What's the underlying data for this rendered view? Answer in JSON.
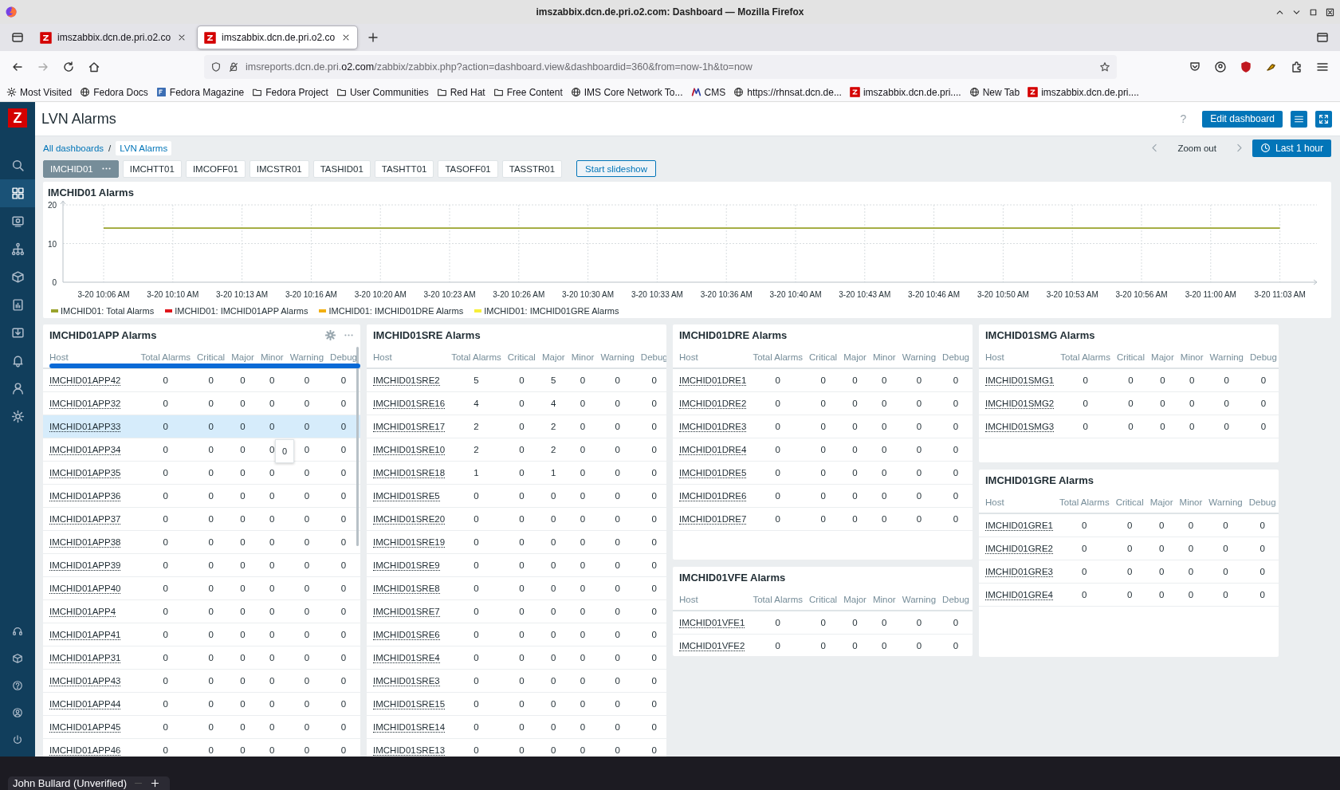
{
  "browser": {
    "window_title": "imszabbix.dcn.de.pri.o2.com: Dashboard — Mozilla Firefox",
    "tabs": [
      {
        "title": "imszabbix.dcn.de.pri.o2.co",
        "selected": false
      },
      {
        "title": "imszabbix.dcn.de.pri.o2.co",
        "selected": true
      }
    ],
    "url": {
      "subdomain": "imsreports.dcn.de.pri.",
      "domain": "o2.com",
      "path": "/zabbix/zabbix.php?action=dashboard.view&dashboardid=360&from=now-1h&to=now"
    },
    "bookmarks": [
      {
        "label": "Most Visited",
        "kind": "gear"
      },
      {
        "label": "Fedora Docs",
        "kind": "globe"
      },
      {
        "label": "Fedora Magazine",
        "kind": "badge"
      },
      {
        "label": "Fedora Project",
        "kind": "folder"
      },
      {
        "label": "User Communities",
        "kind": "folder"
      },
      {
        "label": "Red Hat",
        "kind": "folder"
      },
      {
        "label": "Free Content",
        "kind": "folder"
      },
      {
        "label": "IMS Core Network To...",
        "kind": "globe"
      },
      {
        "label": "CMS",
        "kind": "cms"
      },
      {
        "label": "https://rhnsat.dcn.de...",
        "kind": "globe"
      },
      {
        "label": "imszabbix.dcn.de.pri....",
        "kind": "zabbix"
      },
      {
        "label": "New Tab",
        "kind": "globe"
      },
      {
        "label": "imszabbix.dcn.de.pri....",
        "kind": "zabbix"
      }
    ]
  },
  "sidebar": {
    "logo": "Z",
    "items": [
      {
        "kind": "search",
        "selected": false
      },
      {
        "kind": "grid",
        "selected": true
      },
      {
        "kind": "monitor",
        "selected": false
      },
      {
        "kind": "network",
        "selected": false
      },
      {
        "kind": "cube",
        "selected": false
      },
      {
        "kind": "report",
        "selected": false
      },
      {
        "kind": "inbox",
        "selected": false
      },
      {
        "kind": "bell",
        "selected": false
      },
      {
        "kind": "users",
        "selected": false
      },
      {
        "kind": "gear",
        "selected": false
      }
    ],
    "bottom_items": [
      {
        "kind": "headset"
      },
      {
        "kind": "cube"
      },
      {
        "kind": "help"
      },
      {
        "kind": "user"
      },
      {
        "kind": "power"
      }
    ]
  },
  "header": {
    "title": "LVN Alarms",
    "help": "?",
    "edit_button": "Edit dashboard"
  },
  "breadcrumbs": {
    "items": [
      "All dashboards",
      "LVN Alarms"
    ],
    "separator": "/"
  },
  "time_controls": {
    "zoom_out": "Zoom out",
    "period": "Last 1 hour"
  },
  "dashboard_pages": [
    {
      "label": "IMCHID01",
      "selected": true
    },
    {
      "label": "IMCHTT01",
      "selected": false
    },
    {
      "label": "IMCOFF01",
      "selected": false
    },
    {
      "label": "IMCSTR01",
      "selected": false
    },
    {
      "label": "TASHID01",
      "selected": false
    },
    {
      "label": "TASHTT01",
      "selected": false
    },
    {
      "label": "TASOFF01",
      "selected": false
    },
    {
      "label": "TASSTR01",
      "selected": false
    }
  ],
  "slideshow_button": "Start slideshow",
  "graph_widget": {
    "chart_data": {
      "type": "line",
      "title": "IMCHID01 Alarms",
      "grid": true,
      "ylim": [
        0,
        20
      ],
      "yticks": [
        0,
        10,
        20
      ],
      "categories": [
        "3-20 10:06 AM",
        "3-20 10:10 AM",
        "3-20 10:13 AM",
        "3-20 10:16 AM",
        "3-20 10:20 AM",
        "3-20 10:23 AM",
        "3-20 10:26 AM",
        "3-20 10:30 AM",
        "3-20 10:33 AM",
        "3-20 10:36 AM",
        "3-20 10:40 AM",
        "3-20 10:43 AM",
        "3-20 10:46 AM",
        "3-20 10:50 AM",
        "3-20 10:53 AM",
        "3-20 10:56 AM",
        "3-20 11:00 AM",
        "3-20 11:03 AM"
      ],
      "series": [
        {
          "name": "IMCHID01: Total Alarms",
          "color": "#9aa32c",
          "values": [
            14,
            14,
            14,
            14,
            14,
            14,
            14,
            14,
            14,
            14,
            14,
            14,
            14,
            14,
            14,
            14,
            14,
            14
          ]
        },
        {
          "name": "IMCHID01: IMCHID01APP Alarms",
          "color": "#e0161c",
          "values": [
            null,
            null,
            null,
            null,
            null,
            null,
            null,
            null,
            null,
            null,
            null,
            null,
            null,
            null,
            null,
            null,
            null,
            null
          ]
        },
        {
          "name": "IMCHID01: IMCHID01DRE Alarms",
          "color": "#f2b013",
          "values": [
            null,
            null,
            null,
            null,
            null,
            null,
            null,
            null,
            null,
            null,
            null,
            null,
            null,
            null,
            null,
            null,
            null,
            null
          ]
        },
        {
          "name": "IMCHID01: IMCHID01GRE Alarms",
          "color": "#f7ef3a",
          "values": [
            null,
            null,
            null,
            null,
            null,
            null,
            null,
            null,
            null,
            null,
            null,
            null,
            null,
            null,
            null,
            null,
            null,
            null
          ]
        }
      ]
    }
  },
  "widget_columns": [
    {
      "widgets": [
        {
          "title": "IMCHID01APP Alarms",
          "show_controls": true,
          "scrollbar": true,
          "highlight_stroke": true,
          "tooltip": "0",
          "columns": [
            "Host",
            "Total Alarms",
            "Critical",
            "Major",
            "Minor",
            "Warning",
            "Debug"
          ],
          "rows": [
            {
              "host": "IMCHID01APP42",
              "values": [
                "0",
                "0",
                "0",
                "0",
                "0",
                "0"
              ],
              "hovered": false
            },
            {
              "host": "IMCHID01APP32",
              "values": [
                "0",
                "0",
                "0",
                "0",
                "0",
                "0"
              ],
              "hovered": false
            },
            {
              "host": "IMCHID01APP33",
              "values": [
                "0",
                "0",
                "0",
                "0",
                "0",
                "0"
              ],
              "hovered": true
            },
            {
              "host": "IMCHID01APP34",
              "values": [
                "0",
                "0",
                "0",
                "0",
                "0",
                "0"
              ],
              "hovered": false
            },
            {
              "host": "IMCHID01APP35",
              "values": [
                "0",
                "0",
                "0",
                "0",
                "0",
                "0"
              ],
              "hovered": false
            },
            {
              "host": "IMCHID01APP36",
              "values": [
                "0",
                "0",
                "0",
                "0",
                "0",
                "0"
              ],
              "hovered": false
            },
            {
              "host": "IMCHID01APP37",
              "values": [
                "0",
                "0",
                "0",
                "0",
                "0",
                "0"
              ],
              "hovered": false
            },
            {
              "host": "IMCHID01APP38",
              "values": [
                "0",
                "0",
                "0",
                "0",
                "0",
                "0"
              ],
              "hovered": false
            },
            {
              "host": "IMCHID01APP39",
              "values": [
                "0",
                "0",
                "0",
                "0",
                "0",
                "0"
              ],
              "hovered": false
            },
            {
              "host": "IMCHID01APP40",
              "values": [
                "0",
                "0",
                "0",
                "0",
                "0",
                "0"
              ],
              "hovered": false
            },
            {
              "host": "IMCHID01APP4",
              "values": [
                "0",
                "0",
                "0",
                "0",
                "0",
                "0"
              ],
              "hovered": false
            },
            {
              "host": "IMCHID01APP41",
              "values": [
                "0",
                "0",
                "0",
                "0",
                "0",
                "0"
              ],
              "hovered": false
            },
            {
              "host": "IMCHID01APP31",
              "values": [
                "0",
                "0",
                "0",
                "0",
                "0",
                "0"
              ],
              "hovered": false
            },
            {
              "host": "IMCHID01APP43",
              "values": [
                "0",
                "0",
                "0",
                "0",
                "0",
                "0"
              ],
              "hovered": false
            },
            {
              "host": "IMCHID01APP44",
              "values": [
                "0",
                "0",
                "0",
                "0",
                "0",
                "0"
              ],
              "hovered": false
            },
            {
              "host": "IMCHID01APP45",
              "values": [
                "0",
                "0",
                "0",
                "0",
                "0",
                "0"
              ],
              "hovered": false
            },
            {
              "host": "IMCHID01APP46",
              "values": [
                "0",
                "0",
                "0",
                "0",
                "0",
                "0"
              ],
              "hovered": false
            }
          ]
        }
      ]
    },
    {
      "widgets": [
        {
          "title": "IMCHID01SRE Alarms",
          "columns": [
            "Host",
            "Total Alarms",
            "Critical",
            "Major",
            "Minor",
            "Warning",
            "Debug"
          ],
          "rows": [
            {
              "host": "IMCHID01SRE2",
              "values": [
                "5",
                "0",
                "5",
                "0",
                "0",
                "0"
              ]
            },
            {
              "host": "IMCHID01SRE16",
              "values": [
                "4",
                "0",
                "4",
                "0",
                "0",
                "0"
              ]
            },
            {
              "host": "IMCHID01SRE17",
              "values": [
                "2",
                "0",
                "2",
                "0",
                "0",
                "0"
              ]
            },
            {
              "host": "IMCHID01SRE10",
              "values": [
                "2",
                "0",
                "2",
                "0",
                "0",
                "0"
              ]
            },
            {
              "host": "IMCHID01SRE18",
              "values": [
                "1",
                "0",
                "1",
                "0",
                "0",
                "0"
              ]
            },
            {
              "host": "IMCHID01SRE5",
              "values": [
                "0",
                "0",
                "0",
                "0",
                "0",
                "0"
              ]
            },
            {
              "host": "IMCHID01SRE20",
              "values": [
                "0",
                "0",
                "0",
                "0",
                "0",
                "0"
              ]
            },
            {
              "host": "IMCHID01SRE19",
              "values": [
                "0",
                "0",
                "0",
                "0",
                "0",
                "0"
              ]
            },
            {
              "host": "IMCHID01SRE9",
              "values": [
                "0",
                "0",
                "0",
                "0",
                "0",
                "0"
              ]
            },
            {
              "host": "IMCHID01SRE8",
              "values": [
                "0",
                "0",
                "0",
                "0",
                "0",
                "0"
              ]
            },
            {
              "host": "IMCHID01SRE7",
              "values": [
                "0",
                "0",
                "0",
                "0",
                "0",
                "0"
              ]
            },
            {
              "host": "IMCHID01SRE6",
              "values": [
                "0",
                "0",
                "0",
                "0",
                "0",
                "0"
              ]
            },
            {
              "host": "IMCHID01SRE4",
              "values": [
                "0",
                "0",
                "0",
                "0",
                "0",
                "0"
              ]
            },
            {
              "host": "IMCHID01SRE3",
              "values": [
                "0",
                "0",
                "0",
                "0",
                "0",
                "0"
              ]
            },
            {
              "host": "IMCHID01SRE15",
              "values": [
                "0",
                "0",
                "0",
                "0",
                "0",
                "0"
              ]
            },
            {
              "host": "IMCHID01SRE14",
              "values": [
                "0",
                "0",
                "0",
                "0",
                "0",
                "0"
              ]
            },
            {
              "host": "IMCHID01SRE13",
              "values": [
                "0",
                "0",
                "0",
                "0",
                "0",
                "0"
              ]
            }
          ]
        }
      ]
    },
    {
      "widgets": [
        {
          "title": "IMCHID01DRE Alarms",
          "columns": [
            "Host",
            "Total Alarms",
            "Critical",
            "Major",
            "Minor",
            "Warning",
            "Debug"
          ],
          "rows": [
            {
              "host": "IMCHID01DRE1",
              "values": [
                "0",
                "0",
                "0",
                "0",
                "0",
                "0"
              ]
            },
            {
              "host": "IMCHID01DRE2",
              "values": [
                "0",
                "0",
                "0",
                "0",
                "0",
                "0"
              ]
            },
            {
              "host": "IMCHID01DRE3",
              "values": [
                "0",
                "0",
                "0",
                "0",
                "0",
                "0"
              ]
            },
            {
              "host": "IMCHID01DRE4",
              "values": [
                "0",
                "0",
                "0",
                "0",
                "0",
                "0"
              ]
            },
            {
              "host": "IMCHID01DRE5",
              "values": [
                "0",
                "0",
                "0",
                "0",
                "0",
                "0"
              ]
            },
            {
              "host": "IMCHID01DRE6",
              "values": [
                "0",
                "0",
                "0",
                "0",
                "0",
                "0"
              ]
            },
            {
              "host": "IMCHID01DRE7",
              "values": [
                "0",
                "0",
                "0",
                "0",
                "0",
                "0"
              ]
            }
          ]
        },
        {
          "title": "IMCHID01VFE Alarms",
          "columns": [
            "Host",
            "Total Alarms",
            "Critical",
            "Major",
            "Minor",
            "Warning",
            "Debug"
          ],
          "rows": [
            {
              "host": "IMCHID01VFE1",
              "values": [
                "0",
                "0",
                "0",
                "0",
                "0",
                "0"
              ]
            },
            {
              "host": "IMCHID01VFE2",
              "values": [
                "0",
                "0",
                "0",
                "0",
                "0",
                "0"
              ]
            }
          ]
        }
      ]
    },
    {
      "widgets": [
        {
          "title": "IMCHID01SMG Alarms",
          "columns": [
            "Host",
            "Total Alarms",
            "Critical",
            "Major",
            "Minor",
            "Warning",
            "Debug"
          ],
          "rows": [
            {
              "host": "IMCHID01SMG1",
              "values": [
                "0",
                "0",
                "0",
                "0",
                "0",
                "0"
              ]
            },
            {
              "host": "IMCHID01SMG2",
              "values": [
                "0",
                "0",
                "0",
                "0",
                "0",
                "0"
              ]
            },
            {
              "host": "IMCHID01SMG3",
              "values": [
                "0",
                "0",
                "0",
                "0",
                "0",
                "0"
              ]
            }
          ]
        },
        {
          "title": "IMCHID01GRE Alarms",
          "columns": [
            "Host",
            "Total Alarms",
            "Critical",
            "Major",
            "Minor",
            "Warning",
            "Debug"
          ],
          "rows": [
            {
              "host": "IMCHID01GRE1",
              "values": [
                "0",
                "0",
                "0",
                "0",
                "0",
                "0"
              ]
            },
            {
              "host": "IMCHID01GRE2",
              "values": [
                "0",
                "0",
                "0",
                "0",
                "0",
                "0"
              ]
            },
            {
              "host": "IMCHID01GRE3",
              "values": [
                "0",
                "0",
                "0",
                "0",
                "0",
                "0"
              ]
            },
            {
              "host": "IMCHID01GRE4",
              "values": [
                "0",
                "0",
                "0",
                "0",
                "0",
                "0"
              ]
            }
          ]
        }
      ]
    }
  ],
  "user_bar": {
    "name": "John Bullard (Unverified)"
  }
}
